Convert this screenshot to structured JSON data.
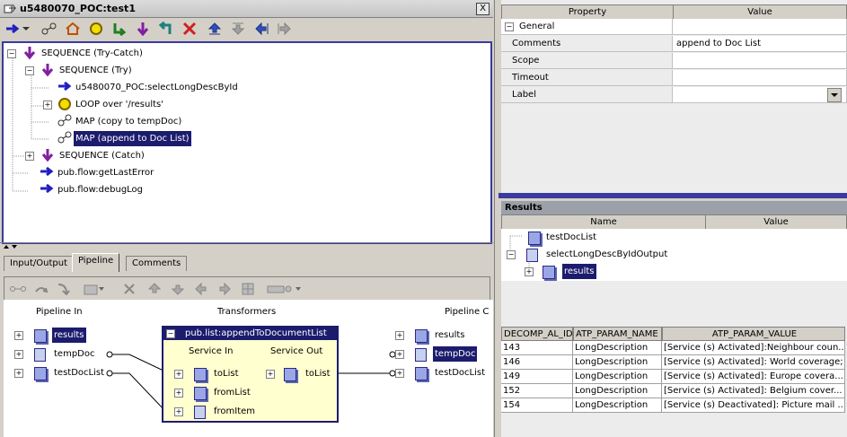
{
  "window": {
    "title": "u5480070_POC:test1",
    "close_label": "X"
  },
  "toolbar": {
    "icons": [
      "step-into-icon",
      "step-over-icon",
      "home-icon",
      "loop-icon",
      "branch-icon",
      "step-down-icon",
      "return-icon",
      "delete-icon",
      "move-up-icon",
      "move-down-icon",
      "move-left-icon",
      "move-right-icon"
    ]
  },
  "tree": {
    "items": [
      {
        "label": "SEQUENCE (Try-Catch)"
      },
      {
        "label": "SEQUENCE (Try)"
      },
      {
        "label": "u5480070_POC:selectLongDescById"
      },
      {
        "label": "LOOP over '/results'"
      },
      {
        "label": "MAP (copy to tempDoc)"
      },
      {
        "label": "MAP (append to Doc List)"
      },
      {
        "label": "SEQUENCE (Catch)"
      },
      {
        "label": "pub.flow:getLastError"
      },
      {
        "label": "pub.flow:debugLog"
      }
    ]
  },
  "tabs": [
    {
      "label": "Input/Output"
    },
    {
      "label": "Pipeline"
    },
    {
      "label": "Comments"
    }
  ],
  "pipeline": {
    "pipeline_in": "Pipeline In",
    "transformers": "Transformers",
    "pipeline_out": "Pipeline C",
    "in_items": [
      {
        "label": "results"
      },
      {
        "label": "tempDoc"
      },
      {
        "label": "testDocList"
      }
    ],
    "out_items": [
      {
        "label": "results"
      },
      {
        "label": "tempDoc"
      },
      {
        "label": "testDocList"
      }
    ],
    "transformer": {
      "title": "pub.list:appendToDocumentList",
      "service_in": "Service In",
      "service_out": "Service Out",
      "inputs": [
        {
          "label": "toList"
        },
        {
          "label": "fromList"
        },
        {
          "label": "fromItem"
        }
      ],
      "outputs": [
        {
          "label": "toList"
        }
      ]
    }
  },
  "properties": {
    "col_property": "Property",
    "col_value": "Value",
    "group": "General",
    "rows": [
      {
        "name": "Comments",
        "value": "append to Doc List"
      },
      {
        "name": "Scope",
        "value": ""
      },
      {
        "name": "Timeout",
        "value": ""
      },
      {
        "name": "Label",
        "value": ""
      }
    ]
  },
  "results": {
    "title": "Results",
    "col_name": "Name",
    "col_value": "Value",
    "items": [
      {
        "label": "testDocList"
      },
      {
        "label": "selectLongDescByIdOutput"
      },
      {
        "label": "results"
      }
    ]
  },
  "datatable": {
    "headers": [
      "DECOMP_AL_ID",
      "ATP_PARAM_NAME",
      "ATP_PARAM_VALUE"
    ],
    "rows": [
      [
        "143",
        "LongDescription",
        "[Service (s) Activated]:Neighbour coun..."
      ],
      [
        "146",
        "LongDescription",
        "[Service (s) Activated]: World coverage;"
      ],
      [
        "149",
        "LongDescription",
        "[Service (s) Activated]: Europe covera..."
      ],
      [
        "152",
        "LongDescription",
        "[Service (s) Activated]: Belgium cover..."
      ],
      [
        "154",
        "LongDescription",
        "[Service (s) Deactivated]: Picture mail ..."
      ]
    ]
  },
  "colors": {
    "selection": "#1c1c6e",
    "accent": "#3a3aa0",
    "transformer_bg": "#ffffd0"
  }
}
